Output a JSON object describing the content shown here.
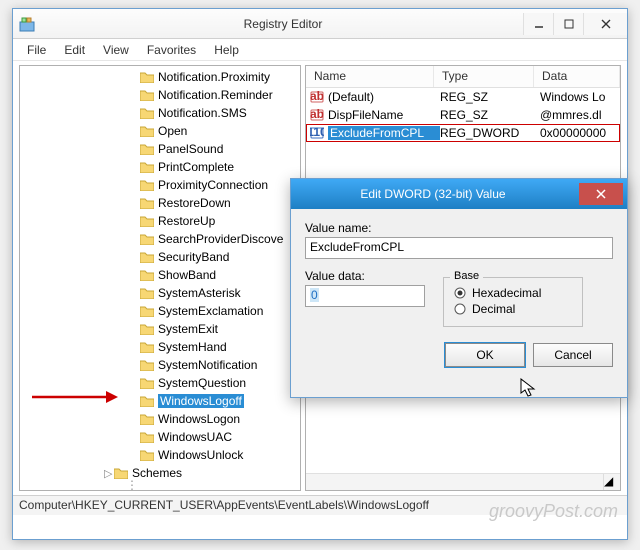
{
  "window": {
    "title": "Registry Editor",
    "menu": [
      "File",
      "Edit",
      "View",
      "Favorites",
      "Help"
    ],
    "statusbar": "Computer\\HKEY_CURRENT_USER\\AppEvents\\EventLabels\\WindowsLogoff"
  },
  "tree": {
    "items": [
      "Notification.Proximity",
      "Notification.Reminder",
      "Notification.SMS",
      "Open",
      "PanelSound",
      "PrintComplete",
      "ProximityConnection",
      "RestoreDown",
      "RestoreUp",
      "SearchProviderDiscove",
      "SecurityBand",
      "ShowBand",
      "SystemAsterisk",
      "SystemExclamation",
      "SystemExit",
      "SystemHand",
      "SystemNotification",
      "SystemQuestion",
      "WindowsLogoff",
      "WindowsLogon",
      "WindowsUAC",
      "WindowsUnlock"
    ],
    "schemes": "Schemes",
    "highlighted_index": 18
  },
  "list": {
    "columns": [
      "Name",
      "Type",
      "Data"
    ],
    "rows": [
      {
        "icon": "ab",
        "name": "(Default)",
        "type": "REG_SZ",
        "data": "Windows Lo"
      },
      {
        "icon": "ab",
        "name": "DispFileName",
        "type": "REG_SZ",
        "data": "@mmres.dl"
      },
      {
        "icon": "dw",
        "name": "ExcludeFromCPL",
        "type": "REG_DWORD",
        "data": "0x00000000"
      }
    ],
    "highlighted_row": 2
  },
  "dialog": {
    "title": "Edit DWORD (32-bit) Value",
    "value_name_label": "Value name:",
    "value_name": "ExcludeFromCPL",
    "value_data_label": "Value data:",
    "value_data": "0",
    "base_label": "Base",
    "base_options": [
      "Hexadecimal",
      "Decimal"
    ],
    "base_selected": 0,
    "ok": "OK",
    "cancel": "Cancel"
  },
  "watermark": "groovyPost.com"
}
